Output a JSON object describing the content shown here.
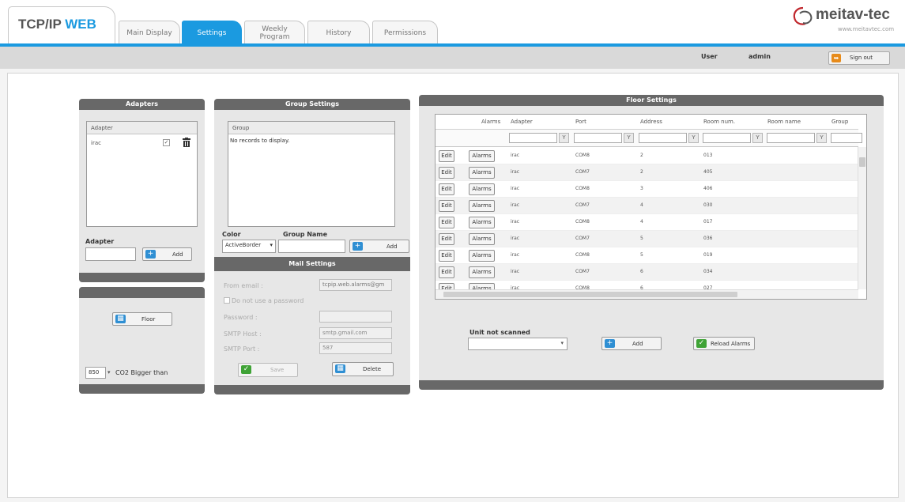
{
  "app": {
    "title_part1": "TCP/IP ",
    "title_part2": "WEB",
    "brand_name": "meitav-tec",
    "brand_url": "www.meitavtec.com"
  },
  "tabs": [
    {
      "label": "Main Display",
      "active": false
    },
    {
      "label": "Settings",
      "active": true
    },
    {
      "label": "Weekly\nProgram",
      "active": false
    },
    {
      "label": "History",
      "active": false
    },
    {
      "label": "Permissions",
      "active": false
    }
  ],
  "userbar": {
    "user_label": "User",
    "user_name": "admin",
    "sign_out": "Sign out"
  },
  "adapters": {
    "title": "Adapters",
    "column": "Adapter",
    "rows": [
      {
        "name": "irac"
      }
    ],
    "field_label": "Adapter",
    "field_value": "",
    "add_label": "Add"
  },
  "floor_panel": {
    "floor_button": "Floor",
    "co2_value": "850",
    "co2_label": "CO2 Bigger than"
  },
  "group_settings": {
    "title": "Group Settings",
    "column": "Group",
    "empty_text": "No records to display.",
    "color_label": "Color",
    "color_value": "ActiveBorder",
    "group_name_label": "Group Name",
    "group_name_value": "",
    "add_label": "Add"
  },
  "mail_settings": {
    "title": "Mail Settings",
    "from_email_label": "From email :",
    "from_email_value": "tcpip.web.alarms@gm",
    "no_password_label": "Do not use a password",
    "password_label": "Password :",
    "password_value": "",
    "smtp_host_label": "SMTP Host :",
    "smtp_host_value": "smtp.gmail.com",
    "smtp_port_label": "SMTP Port :",
    "smtp_port_value": "587",
    "save_label": "Save",
    "delete_label": "Delete"
  },
  "floor_settings": {
    "title": "Floor Settings",
    "columns": {
      "alarms": "Alarms",
      "adapter": "Adapter",
      "port": "Port",
      "address": "Address",
      "room_num": "Room num.",
      "room_name": "Room name",
      "group": "Group"
    },
    "edit_label": "Edit",
    "alarms_button_label": "Alarms",
    "rows": [
      {
        "adapter": "irac",
        "port": "COM8",
        "address": "2",
        "room_num": "013"
      },
      {
        "adapter": "irac",
        "port": "COM7",
        "address": "2",
        "room_num": "405"
      },
      {
        "adapter": "irac",
        "port": "COM8",
        "address": "3",
        "room_num": "406"
      },
      {
        "adapter": "irac",
        "port": "COM7",
        "address": "4",
        "room_num": "030"
      },
      {
        "adapter": "irac",
        "port": "COM8",
        "address": "4",
        "room_num": "017"
      },
      {
        "adapter": "irac",
        "port": "COM7",
        "address": "5",
        "room_num": "036"
      },
      {
        "adapter": "irac",
        "port": "COM8",
        "address": "5",
        "room_num": "019"
      },
      {
        "adapter": "irac",
        "port": "COM7",
        "address": "6",
        "room_num": "034"
      },
      {
        "adapter": "irac",
        "port": "COM8",
        "address": "6",
        "room_num": "027"
      }
    ],
    "unit_label": "Unit not scanned",
    "unit_value": "",
    "add_label": "Add",
    "reload_label": "Reload Alarms"
  }
}
